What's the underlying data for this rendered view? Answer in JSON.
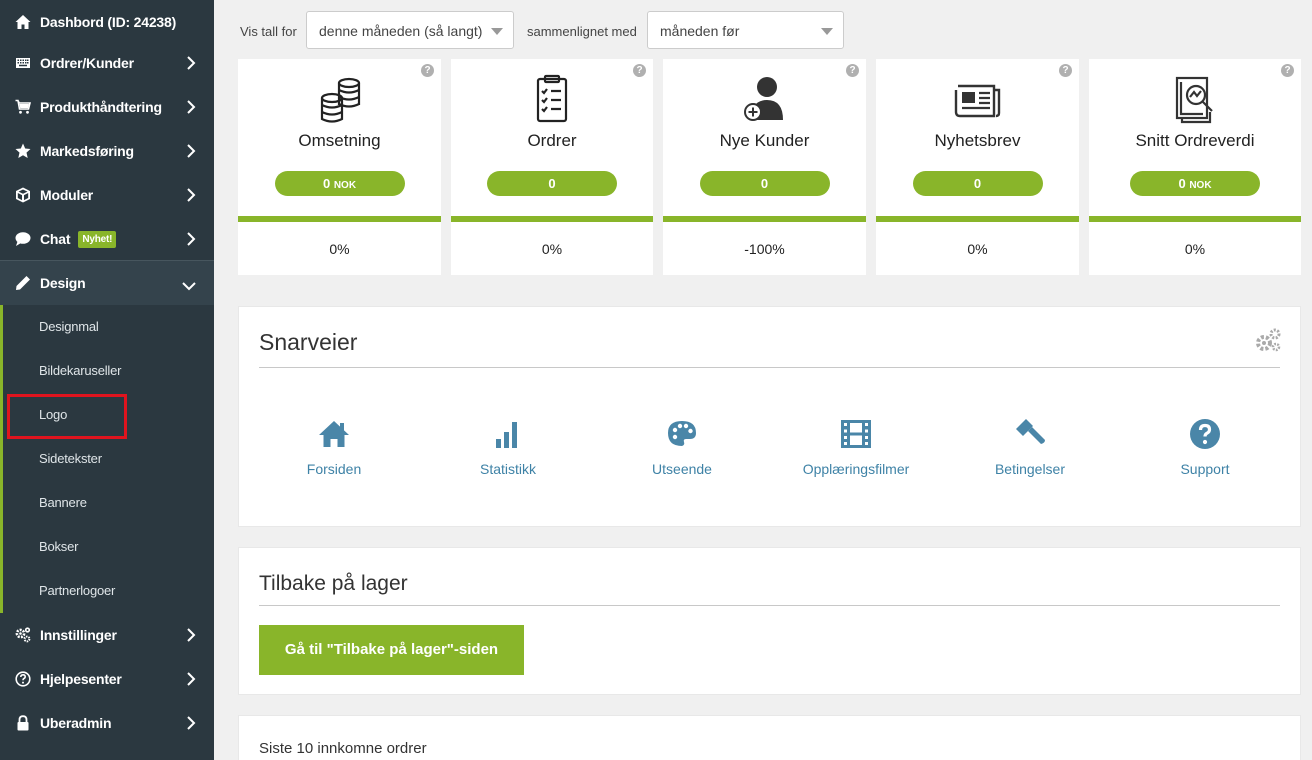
{
  "sidebar": {
    "items": [
      {
        "label": "Dashbord (ID: 24238)",
        "icon": "home-icon"
      },
      {
        "label": "Ordrer/Kunder",
        "icon": "keyboard-icon"
      },
      {
        "label": "Produkthåndtering",
        "icon": "cart-icon"
      },
      {
        "label": "Markedsføring",
        "icon": "star-icon"
      },
      {
        "label": "Moduler",
        "icon": "cube-icon"
      },
      {
        "label": "Chat",
        "icon": "chat-icon",
        "badge": "Nyhet!"
      },
      {
        "label": "Design",
        "icon": "pencil-icon"
      },
      {
        "label": "Innstillinger",
        "icon": "cogs-icon"
      },
      {
        "label": "Hjelpesenter",
        "icon": "question-icon"
      },
      {
        "label": "Uberadmin",
        "icon": "lock-icon"
      }
    ],
    "design_submenu": [
      "Designmal",
      "Bildekaruseller",
      "Logo",
      "Sidetekster",
      "Bannere",
      "Bokser",
      "Partnerlogoer"
    ]
  },
  "filters": {
    "show_label": "Vis tall for",
    "show_value": "denne måneden (så langt)",
    "compare_label": "sammenlignet med",
    "compare_value": "måneden før"
  },
  "stats": [
    {
      "title": "Omsetning",
      "value": "0",
      "unit": "NOK",
      "change": "0%",
      "icon": "coins-icon"
    },
    {
      "title": "Ordrer",
      "value": "0",
      "unit": "",
      "change": "0%",
      "icon": "clipboard-icon"
    },
    {
      "title": "Nye Kunder",
      "value": "0",
      "unit": "",
      "change": "-100%",
      "icon": "add-user-icon"
    },
    {
      "title": "Nyhetsbrev",
      "value": "0",
      "unit": "",
      "change": "0%",
      "icon": "newspaper-icon"
    },
    {
      "title": "Snitt Ordreverdi",
      "value": "0",
      "unit": "NOK",
      "change": "0%",
      "icon": "report-icon"
    }
  ],
  "help_glyph": "?",
  "shortcuts": {
    "title": "Snarveier",
    "items": [
      {
        "label": "Forsiden",
        "icon": "home-icon"
      },
      {
        "label": "Statistikk",
        "icon": "bar-chart-icon"
      },
      {
        "label": "Utseende",
        "icon": "palette-icon"
      },
      {
        "label": "Opplæringsfilmer",
        "icon": "film-icon"
      },
      {
        "label": "Betingelser",
        "icon": "gavel-icon"
      },
      {
        "label": "Support",
        "icon": "question-icon"
      }
    ]
  },
  "back_in_stock": {
    "title": "Tilbake på lager",
    "button": "Gå til \"Tilbake på lager\"-siden"
  },
  "recent_orders": {
    "title": "Siste 10 innkomne ordrer"
  },
  "colors": {
    "sidebar_bg": "#2b3840",
    "accent_green": "#89b52a",
    "link_blue": "#3e82a6",
    "highlight_red": "#e0141e"
  }
}
